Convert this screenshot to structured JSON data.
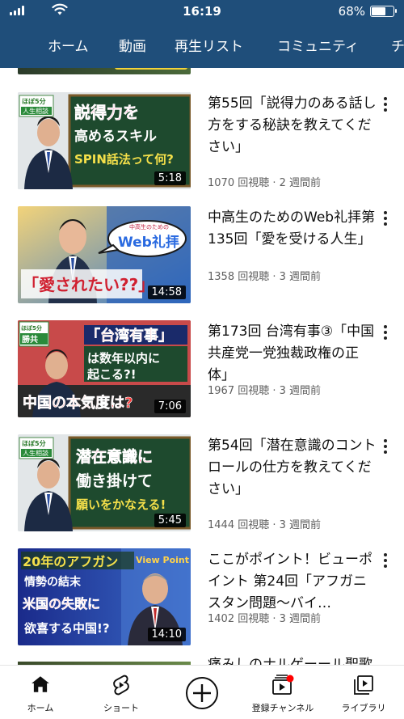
{
  "status_bar": {
    "time": "16:19",
    "battery": "68%",
    "battery_level": 0.68
  },
  "tabs": [
    "ホーム",
    "動画",
    "再生リスト",
    "コミュニティ",
    "チ"
  ],
  "videos": [
    {
      "title": "第55回「説得力のある話し方をする秘訣を教えてください」",
      "meta": "1070 回視聴 · 2 週間前",
      "duration": "5:18",
      "thumb_text": [
        "説得力を",
        "高めるスキル",
        "SPIN話法って何?"
      ],
      "thumb_badge": [
        "ほぼ5分",
        "人生相談"
      ]
    },
    {
      "title": "中高生のためのWeb礼拝第135回「愛を受ける人生」",
      "meta": "1358 回視聴 · 3 週間前",
      "duration": "14:58",
      "thumb_text": [
        "中高生のための",
        "Web礼拝",
        "「愛されたい??」"
      ]
    },
    {
      "title": "第173回 台湾有事③「中国共産党一党独裁政権の正体」",
      "meta": "1967 回視聴 · 3 週間前",
      "duration": "7:06",
      "thumb_text": [
        "「台湾有事」",
        "は数年以内に",
        "起こる?!",
        "中国の本気度は?"
      ],
      "thumb_badge": [
        "ほぼ5分",
        "勝共"
      ]
    },
    {
      "title": "第54回「潜在意識のコントロールの仕方を教えてください」",
      "meta": "1444 回視聴 · 3 週間前",
      "duration": "5:45",
      "thumb_text": [
        "潜在意識に",
        "働き掛けて",
        "願いをかなえる!"
      ],
      "thumb_badge": [
        "ほぼ5分",
        "人生相談"
      ]
    },
    {
      "title": "ここがポイント！ビューポイント 第24回「アフガニスタン問題〜バイ…",
      "meta": "1402 回視聴 · 3 週間前",
      "duration": "14:10",
      "thumb_text": [
        "20年のアフガン",
        "情勢の結末",
        "米国の失敗に",
        "欲喜する中国!?",
        "View Point"
      ]
    }
  ],
  "next_partial_title": "痛みしのナルゲーール聖歌",
  "bottom_nav": [
    {
      "label": "ホーム",
      "icon": "home-icon"
    },
    {
      "label": "ショート",
      "icon": "shorts-icon"
    },
    {
      "label": "",
      "icon": "create-plus-icon"
    },
    {
      "label": "登録チャンネル",
      "icon": "subscriptions-icon"
    },
    {
      "label": "ライブラリ",
      "icon": "library-icon"
    }
  ]
}
